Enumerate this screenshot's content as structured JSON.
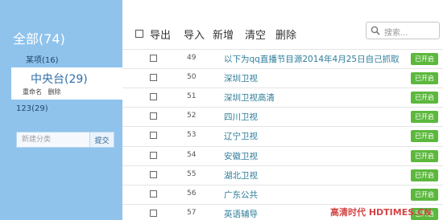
{
  "sidebar": {
    "header": "全部(74)",
    "items": [
      {
        "label": "某项(16)"
      },
      {
        "label": "123(29)"
      }
    ],
    "active": {
      "label": "中央台(29)",
      "rename": "重命名",
      "delete": "删除"
    },
    "new_category": {
      "placeholder": "新建分类",
      "submit": "提交"
    }
  },
  "toolbar": {
    "export": "导出",
    "import": "导入",
    "add": "新增",
    "clear": "清空",
    "delete": "删除",
    "search_placeholder": "搜索..."
  },
  "rows": [
    {
      "num": "49",
      "name": "以下为qq直播节目源2014年4月25日自己抓取",
      "status": "已开启"
    },
    {
      "num": "50",
      "name": "深圳卫视",
      "status": "已开启"
    },
    {
      "num": "51",
      "name": "深圳卫视高清",
      "status": "已开启"
    },
    {
      "num": "52",
      "name": "四川卫视",
      "status": "已开启"
    },
    {
      "num": "53",
      "name": "辽宁卫视",
      "status": "已开启"
    },
    {
      "num": "54",
      "name": "安徽卫视",
      "status": "已开启"
    },
    {
      "num": "55",
      "name": "湖北卫视",
      "status": "已开启"
    },
    {
      "num": "56",
      "name": "广东公共",
      "status": "已开启"
    },
    {
      "num": "57",
      "name": "英语辅导",
      "status": "已开启"
    }
  ],
  "watermark": "高清时代 HDTIMES.CN",
  "colors": {
    "sidebar_bg": "#8fc3ec",
    "badge_green": "#5cb83d",
    "link_teal": "#2e7d9a"
  }
}
